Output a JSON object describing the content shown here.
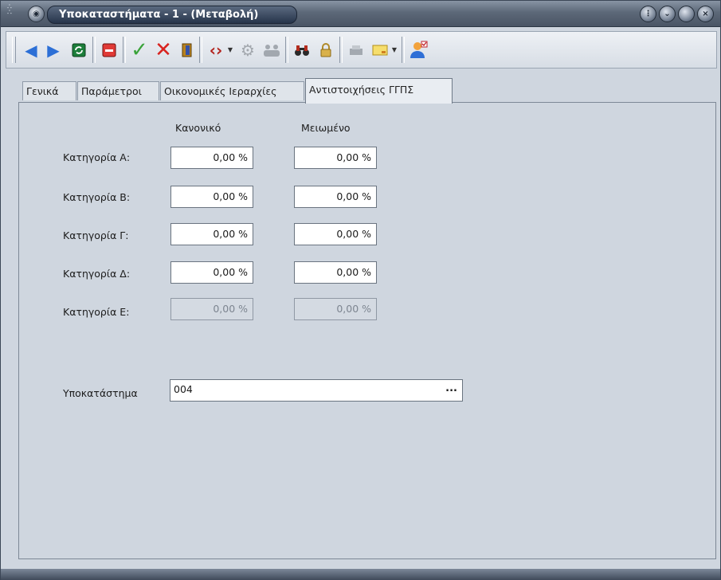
{
  "window": {
    "title": "Υποκαταστήματα - 1 - (Μεταβολή)"
  },
  "toolbar": {
    "buttons": [
      {
        "name": "previous-record",
        "icon": "triangle-left-icon"
      },
      {
        "name": "next-record",
        "icon": "triangle-right-icon"
      },
      {
        "name": "refresh",
        "icon": "refresh-icon"
      },
      {
        "name": "delete",
        "icon": "delete-icon"
      },
      {
        "name": "save",
        "icon": "check-icon"
      },
      {
        "name": "cancel",
        "icon": "x-icon"
      },
      {
        "name": "exit",
        "icon": "door-icon"
      },
      {
        "name": "code",
        "icon": "code-icon"
      },
      {
        "name": "process",
        "icon": "gear-icon"
      },
      {
        "name": "group",
        "icon": "group-icon"
      },
      {
        "name": "find",
        "icon": "binoculars-icon"
      },
      {
        "name": "lock",
        "icon": "lock-icon"
      },
      {
        "name": "print",
        "icon": "printer-icon"
      },
      {
        "name": "note",
        "icon": "note-icon"
      },
      {
        "name": "user",
        "icon": "user-icon"
      }
    ]
  },
  "tabs": [
    {
      "label": "Γενικά",
      "active": false
    },
    {
      "label": "Παράμετροι",
      "active": false
    },
    {
      "label": "Οικονομικές Ιεραρχίες",
      "active": false
    },
    {
      "label": "Αντιστοιχήσεις ΓΓΠΣ",
      "active": true
    }
  ],
  "form": {
    "columns": [
      "Κανονικό",
      "Μειωμένο"
    ],
    "rows": [
      {
        "label": "Κατηγορία Α:",
        "normal": "0,00 %",
        "reduced": "0,00 %",
        "enabled": true
      },
      {
        "label": "Κατηγορία Β:",
        "normal": "0,00 %",
        "reduced": "0,00 %",
        "enabled": true
      },
      {
        "label": "Κατηγορία Γ:",
        "normal": "0,00 %",
        "reduced": "0,00 %",
        "enabled": true
      },
      {
        "label": "Κατηγορία Δ:",
        "normal": "0,00 %",
        "reduced": "0,00 %",
        "enabled": true
      },
      {
        "label": "Κατηγορία Ε:",
        "normal": "0,00 %",
        "reduced": "0,00 %",
        "enabled": false
      }
    ],
    "branch": {
      "label": "Υποκατάστημα",
      "value": "004",
      "lookup": "..."
    }
  }
}
